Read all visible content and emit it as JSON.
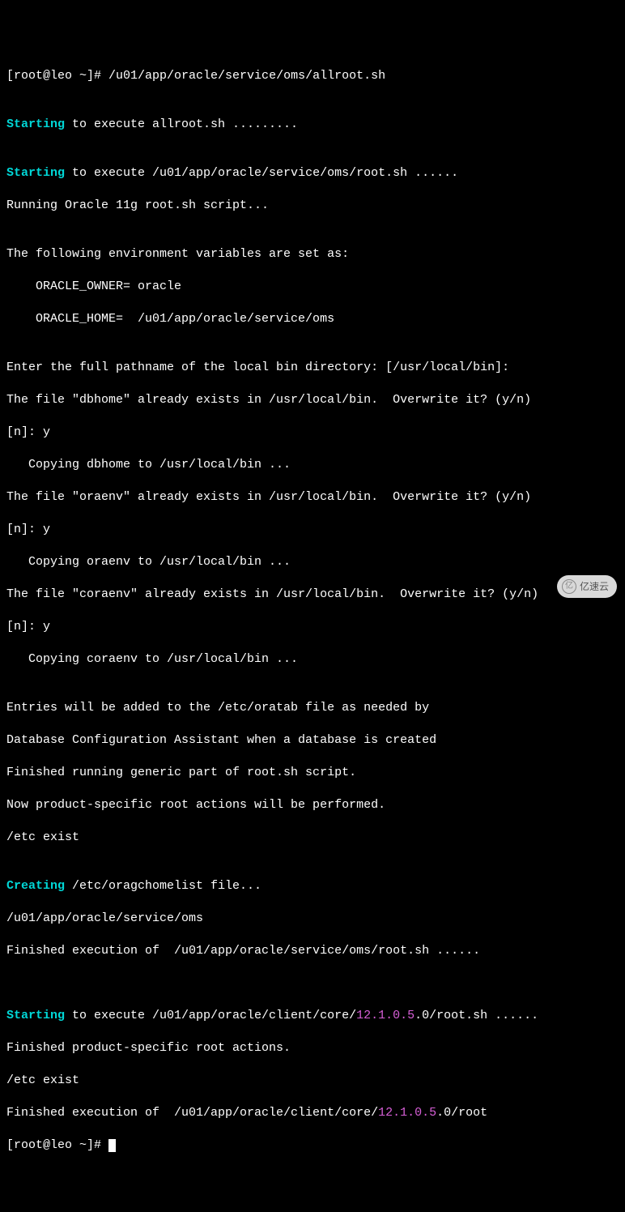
{
  "term": {
    "prompt": "[root@leo ~]# ",
    "command": "/u01/app/oracle/service/oms/allroot.sh",
    "blank": "",
    "starting": "Starting",
    "creating": "Creating",
    "line_exec_allroot": " to execute allroot.sh .........",
    "line_exec_oms_root": " to execute /u01/app/oracle/service/oms/root.sh ......",
    "line_running_11g": "Running Oracle 11g root.sh script...",
    "line_env_header": "The following environment variables are set as:",
    "line_oracle_owner": "    ORACLE_OWNER= oracle",
    "line_oracle_home": "    ORACLE_HOME=  /u01/app/oracle/service/oms",
    "line_enter_bin": "Enter the full pathname of the local bin directory: [/usr/local/bin]:",
    "line_dbhome_exists": "The file \"dbhome\" already exists in /usr/local/bin.  Overwrite it? (y/n)",
    "line_ny": "[n]: y",
    "line_copy_dbhome": "   Copying dbhome to /usr/local/bin ...",
    "line_oraenv_exists": "The file \"oraenv\" already exists in /usr/local/bin.  Overwrite it? (y/n)",
    "line_copy_oraenv": "   Copying oraenv to /usr/local/bin ...",
    "line_coraenv_exists": "The file \"coraenv\" already exists in /usr/local/bin.  Overwrite it? (y/n)",
    "line_copy_coraenv": "   Copying coraenv to /usr/local/bin ...",
    "line_entries": "Entries will be added to the /etc/oratab file as needed by",
    "line_dbca": "Database Configuration Assistant when a database is created",
    "line_finished_generic": "Finished running generic part of root.sh script.",
    "line_product_specific": "Now product-specific root actions will be performed.",
    "line_etc_exist": "/etc exist",
    "line_creating_oragchomelist": " /etc/oragchomelist file...",
    "line_oms_path": "/u01/app/oracle/service/oms",
    "line_finished_oms": "Finished execution of  /u01/app/oracle/service/oms/root.sh ......",
    "line_exec_client_pre": " to execute /u01/app/oracle/client/core/",
    "version": "12.1.0.5",
    "line_exec_client_post": ".0/root.sh ......",
    "line_finished_product": "Finished product-specific root actions.",
    "line_finished_client_pre": "Finished execution of  /u01/app/oracle/client/core/",
    "line_finished_client_post": ".0/root",
    "prompt2": "[root@leo ~]# "
  },
  "watermark": {
    "icon": "亿",
    "text": "亿速云"
  }
}
